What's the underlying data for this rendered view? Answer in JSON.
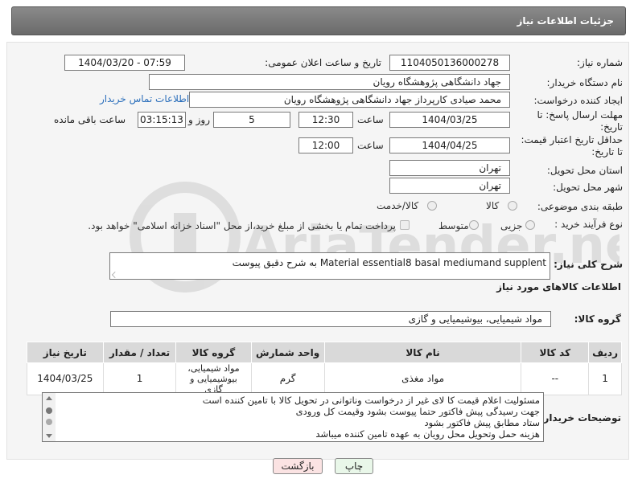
{
  "header": {
    "title": "جزئیات اطلاعات نیاز"
  },
  "form": {
    "need_number_label": "شماره نیاز:",
    "need_number": "1104050136000278",
    "announce_label": "تاریخ و ساعت اعلان عمومی:",
    "announce_value": "1404/03/20 - 07:59",
    "buyer_org_label": "نام دستگاه خریدار:",
    "buyer_org": "جهاد دانشگاهی پژوهشگاه رویان",
    "creator_label": "ایجاد کننده درخواست:",
    "creator": "محمد صیادی کارپرداز جهاد دانشگاهی پژوهشگاه رویان",
    "contact_link": "اطلاعات تماس خریدار",
    "deadline_label_1": "مهلت ارسال پاسخ: تا",
    "deadline_label_2": "تاریخ:",
    "deadline_date": "1404/03/25",
    "time_label": "ساعت",
    "deadline_time": "12:30",
    "days_value": "5",
    "days_label": "روز و",
    "remaining_time": "03:15:13",
    "remaining_label": "ساعت باقی مانده",
    "validity_label_1": "حداقل تاریخ اعتبار قیمت:",
    "validity_label_2": "تا تاریخ:",
    "validity_date": "1404/04/25",
    "validity_time": "12:00",
    "province_label": "استان محل تحویل:",
    "province": "تهران",
    "city_label": "شهر محل تحویل:",
    "city": "تهران",
    "category_label": "طبقه بندی موضوعی:",
    "category_options": [
      "کالا",
      "کالا/خدمت"
    ],
    "process_label": "نوع فرآیند خرید :",
    "process_options": [
      "جزیی",
      "متوسط"
    ],
    "payment_note": "پرداخت تمام یا بخشی از مبلغ خرید،از محل \"اسناد خزانه اسلامی\" خواهد بود.",
    "description_label": "شرح کلی نیاز:",
    "description": "Material essential8 basal mediumand supplent به شرح دقیق پیوست",
    "items_heading": "اطلاعات کالاهای مورد نیاز",
    "group_label": "گروه کالا:",
    "group_value": "مواد شیمیایی، بیوشیمیایی و  گازی"
  },
  "table": {
    "headers": [
      "ردیف",
      "کد کالا",
      "نام کالا",
      "واحد شمارش",
      "گروه کالا",
      "تعداد / مقدار",
      "تاریخ نیاز"
    ],
    "rows": [
      [
        "1",
        "--",
        "مواد مغذی",
        "گرم",
        "مواد شیمیایی، بیوشیمیایی و گازی",
        "1",
        "1404/03/25"
      ]
    ]
  },
  "notes": {
    "label": "توضیحات خریدار:",
    "lines": [
      "مسئولیت اعلام قیمت کا لای  غیر از درخواست وناتوانی در تحویل کالا با تامین کننده است",
      "جهت رسیدگی پیش فاکتور حتما پیوست بشود وقیمت کل ورودی",
      "ستاد مطابق پیش فاکتور بشود",
      "هزینه حمل وتحویل محل رویان به عهده تامین کننده میباشد"
    ]
  },
  "buttons": {
    "print": "چاپ",
    "back": "بازگشت"
  },
  "watermark": {
    "text": "AriaTender.net"
  },
  "colors": {
    "header_bg": "#777777",
    "link": "#2a6ebb",
    "print_btn": "#e9f7e9",
    "back_btn": "#fbe3e3"
  }
}
